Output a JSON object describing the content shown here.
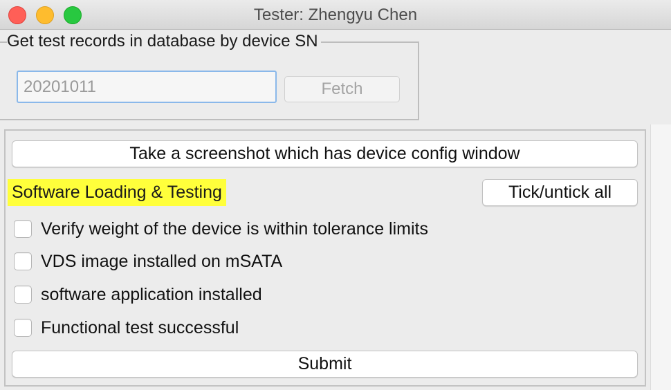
{
  "window": {
    "title": "Tester: Zhengyu Chen"
  },
  "lookup": {
    "legend": "Get test records in database by device SN",
    "sn_value": "20201011",
    "fetch_label": "Fetch"
  },
  "checklist": {
    "screenshot_button": "Take a screenshot which has device config window",
    "section_title": "Software Loading & Testing",
    "section_highlight_color": "#ffff3b",
    "tick_all_button": "Tick/untick all",
    "items": [
      {
        "label": "Verify weight of the device is within tolerance limits",
        "checked": false
      },
      {
        "label": "VDS image installed on mSATA",
        "checked": false
      },
      {
        "label": "software application installed",
        "checked": false
      },
      {
        "label": "Functional test successful",
        "checked": false
      }
    ],
    "submit_button": "Submit"
  }
}
